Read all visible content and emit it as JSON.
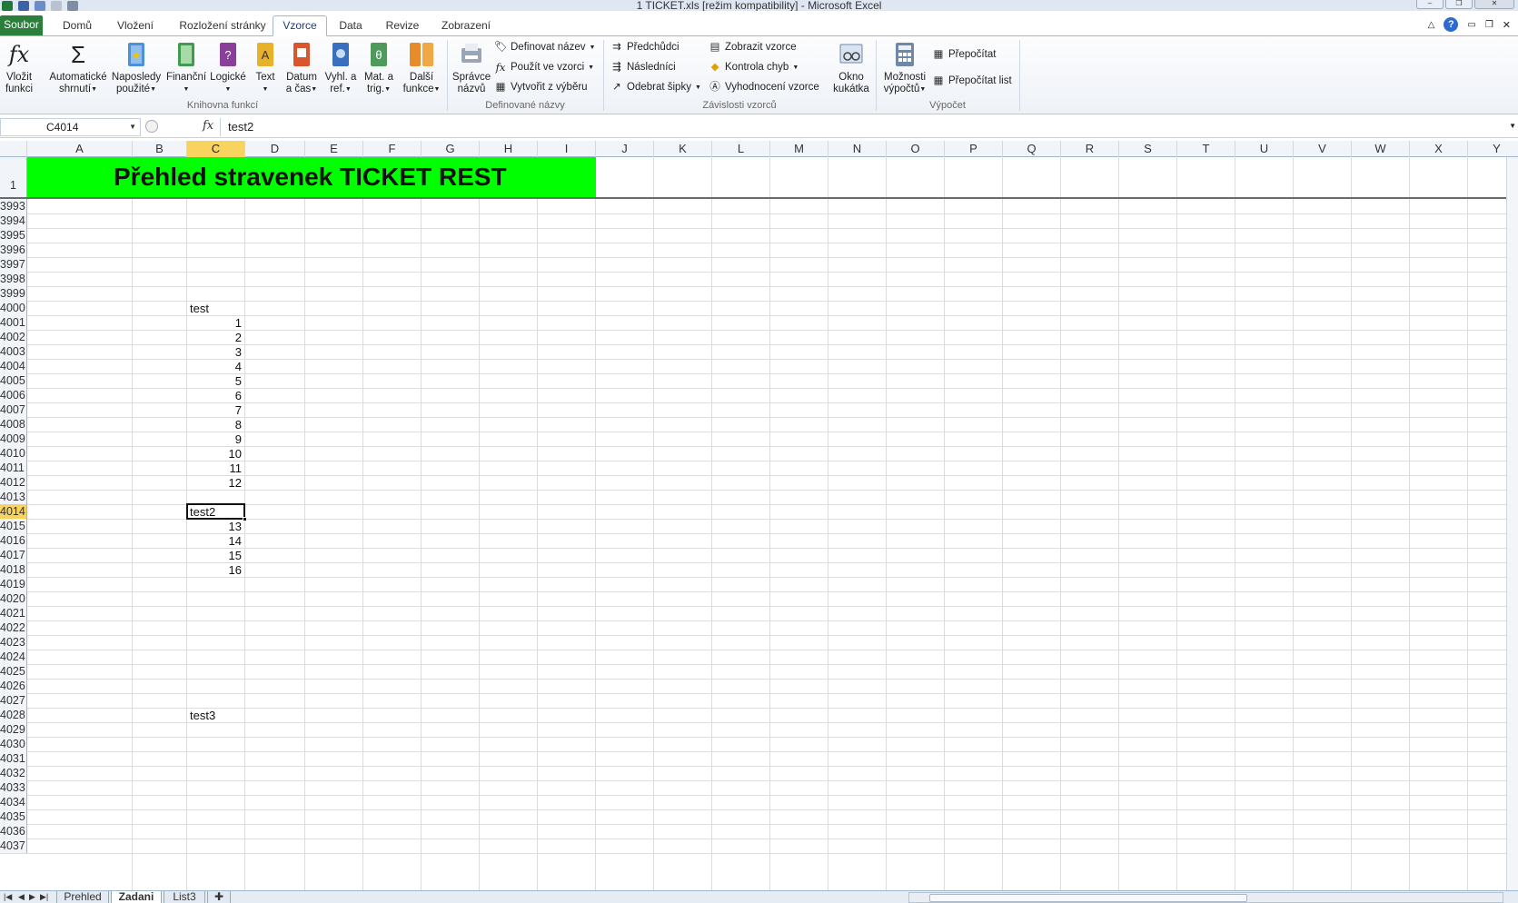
{
  "window": {
    "title": "1 TICKET.xls  [režim kompatibility]  -  Microsoft Excel"
  },
  "tabs": [
    {
      "key": "file",
      "label": "Soubor"
    },
    {
      "key": "home",
      "label": "Domů"
    },
    {
      "key": "insert",
      "label": "Vložení"
    },
    {
      "key": "layout",
      "label": "Rozložení stránky"
    },
    {
      "key": "formulas",
      "label": "Vzorce"
    },
    {
      "key": "data",
      "label": "Data"
    },
    {
      "key": "review",
      "label": "Revize"
    },
    {
      "key": "view",
      "label": "Zobrazení"
    }
  ],
  "ribbon": {
    "library": {
      "insert_function": {
        "l1": "Vložit",
        "l2": "funkci"
      },
      "autosum": {
        "l1": "Automatické",
        "l2": "shrnutí"
      },
      "recent": {
        "l1": "Naposledy",
        "l2": "použité"
      },
      "financial": {
        "l1": "Finanční"
      },
      "logical": {
        "l1": "Logické"
      },
      "text": {
        "l1": "Text"
      },
      "datetime": {
        "l1": "Datum",
        "l2": "a čas"
      },
      "lookup": {
        "l1": "Vyhl. a",
        "l2": "ref."
      },
      "math": {
        "l1": "Mat. a",
        "l2": "trig."
      },
      "more": {
        "l1": "Další",
        "l2": "funkce"
      },
      "group_label": "Knihovna funkcí"
    },
    "names": {
      "manager": {
        "l1": "Správce",
        "l2": "názvů"
      },
      "define": "Definovat název",
      "use": "Použít ve vzorci",
      "create": "Vytvořit z výběru",
      "group_label": "Definované názvy"
    },
    "auditing": {
      "precedents": "Předchůdci",
      "dependents": "Následníci",
      "remove_arrows": "Odebrat šipky",
      "show_formulas": "Zobrazit vzorce",
      "error_check": "Kontrola chyb",
      "evaluate": "Vyhodnocení vzorce",
      "watch": {
        "l1": "Okno",
        "l2": "kukátka"
      },
      "group_label": "Závislosti vzorců"
    },
    "calculation": {
      "options": {
        "l1": "Možnosti",
        "l2": "výpočtů"
      },
      "calc_now": "Přepočítat",
      "calc_sheet": "Přepočítat list",
      "group_label": "Výpočet"
    }
  },
  "formula_bar": {
    "name_box": "C4014",
    "fx": "fx",
    "value": "test2"
  },
  "columns": [
    "A",
    "B",
    "C",
    "D",
    "E",
    "F",
    "G",
    "H",
    "I",
    "J",
    "K",
    "L",
    "M",
    "N",
    "O",
    "P",
    "Q",
    "R",
    "S",
    "T",
    "U",
    "V",
    "W",
    "X",
    "Y"
  ],
  "banner": "Přehled stravenek  TICKET REST",
  "rows": [
    {
      "n": "3993",
      "c": ""
    },
    {
      "n": "3994",
      "c": ""
    },
    {
      "n": "3995",
      "c": ""
    },
    {
      "n": "3996",
      "c": ""
    },
    {
      "n": "3997",
      "c": ""
    },
    {
      "n": "3998",
      "c": ""
    },
    {
      "n": "3999",
      "c": ""
    },
    {
      "n": "4000",
      "c": "test",
      "t": "txt"
    },
    {
      "n": "4001",
      "c": "1",
      "t": "num"
    },
    {
      "n": "4002",
      "c": "2",
      "t": "num"
    },
    {
      "n": "4003",
      "c": "3",
      "t": "num"
    },
    {
      "n": "4004",
      "c": "4",
      "t": "num"
    },
    {
      "n": "4005",
      "c": "5",
      "t": "num"
    },
    {
      "n": "4006",
      "c": "6",
      "t": "num"
    },
    {
      "n": "4007",
      "c": "7",
      "t": "num"
    },
    {
      "n": "4008",
      "c": "8",
      "t": "num"
    },
    {
      "n": "4009",
      "c": "9",
      "t": "num"
    },
    {
      "n": "4010",
      "c": "10",
      "t": "num"
    },
    {
      "n": "4011",
      "c": "11",
      "t": "num"
    },
    {
      "n": "4012",
      "c": "12",
      "t": "num"
    },
    {
      "n": "4013",
      "c": ""
    },
    {
      "n": "4014",
      "c": "test2",
      "t": "txt"
    },
    {
      "n": "4015",
      "c": "13",
      "t": "num"
    },
    {
      "n": "4016",
      "c": "14",
      "t": "num"
    },
    {
      "n": "4017",
      "c": "15",
      "t": "num"
    },
    {
      "n": "4018",
      "c": "16",
      "t": "num"
    },
    {
      "n": "4019",
      "c": ""
    },
    {
      "n": "4020",
      "c": ""
    },
    {
      "n": "4021",
      "c": ""
    },
    {
      "n": "4022",
      "c": ""
    },
    {
      "n": "4023",
      "c": ""
    },
    {
      "n": "4024",
      "c": ""
    },
    {
      "n": "4025",
      "c": ""
    },
    {
      "n": "4026",
      "c": ""
    },
    {
      "n": "4027",
      "c": ""
    },
    {
      "n": "4028",
      "c": "test3",
      "t": "txt"
    },
    {
      "n": "4029",
      "c": ""
    },
    {
      "n": "4030",
      "c": ""
    },
    {
      "n": "4031",
      "c": ""
    },
    {
      "n": "4032",
      "c": ""
    },
    {
      "n": "4033",
      "c": ""
    },
    {
      "n": "4034",
      "c": ""
    },
    {
      "n": "4035",
      "c": ""
    },
    {
      "n": "4036",
      "c": ""
    },
    {
      "n": "4037",
      "c": ""
    }
  ],
  "first_row": "1",
  "active": {
    "col": "C",
    "row": "4014"
  },
  "sheets": [
    {
      "name": "Prehled",
      "active": false
    },
    {
      "name": "Zadani",
      "active": true
    },
    {
      "name": "List3",
      "active": false
    }
  ],
  "colors": {
    "file_tab": "#2c7f3b",
    "banner": "#00ff00",
    "selected_header": "#f8d35e"
  }
}
